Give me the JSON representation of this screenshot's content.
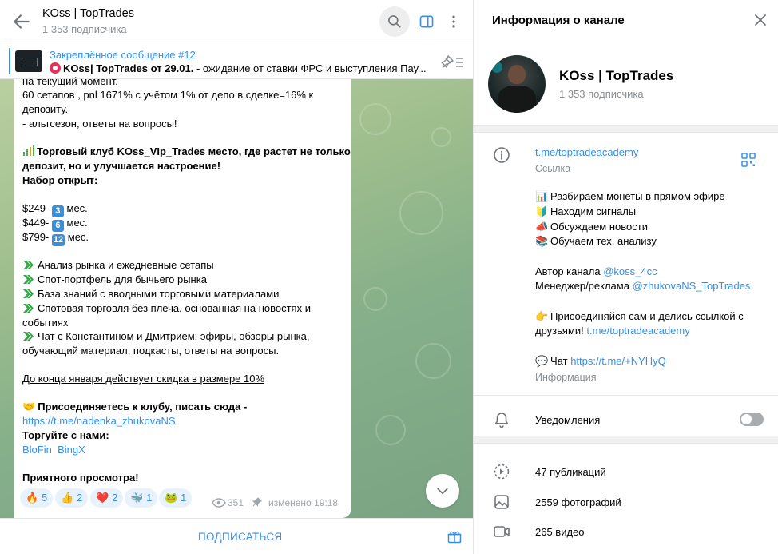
{
  "header": {
    "title": "KOss | TopTrades",
    "subtitle": "1 353 подписчика"
  },
  "pinned": {
    "title": "Закреплённое сообщение #12",
    "text_bold": "KOss| TopTrades от 29.01.",
    "text_rest": " - ожидание от ставки ФРС и выступления Пау..."
  },
  "message": {
    "lines": [
      "на текущий момент.",
      "60 сетапов , pnl 1671% с учётом 1% от депо в сделке=16% к",
      "депозиту.",
      "- альтсезон, ответы на вопросы!"
    ],
    "club_1": "Торговый клуб KOss_VIp_Trades место, где растет не только",
    "club_2": "депозит, но и улучшается настроение!",
    "recruit": "Набор открыт:",
    "prices": [
      {
        "price": "$249-",
        "badge": "3",
        "unit": "мес."
      },
      {
        "price": "$449-",
        "badge": "6",
        "unit": "мес."
      },
      {
        "price": "$799-",
        "badge": "12",
        "unit": "мес."
      }
    ],
    "features": [
      "Анализ рынка и ежедневные  сетапы",
      "Спот-портфель для бычьего рынка",
      "База знаний с вводными торговыми материалами",
      "Спотовая торговля без плеча, основанная на новостях и",
      "событиях",
      "Чат с Константином и Дмитрием:  эфиры, обзоры рынка,",
      "обучающий материал, подкасты, ответы на вопросы."
    ],
    "discount": "До конца января действует скидка в размере 10%",
    "join": "Присоединяетесь к клубу, писать сюда -",
    "join_link": "https://t.me/nadenka_zhukovaNS",
    "trade_with": "Торгуйте с нами:",
    "exchange_1": "BloFin",
    "exchange_2": "BingX",
    "enjoy": "Приятного просмотра!"
  },
  "reactions": [
    {
      "emoji": "🔥",
      "count": "5"
    },
    {
      "emoji": "👍",
      "count": "2"
    },
    {
      "emoji": "❤️",
      "count": "2"
    },
    {
      "emoji": "🐳",
      "count": "1"
    },
    {
      "emoji": "🐸",
      "count": "1"
    }
  ],
  "meta": {
    "views": "351",
    "edited": "изменено 19:18"
  },
  "footer": {
    "subscribe": "ПОДПИСАТЬСЯ"
  },
  "info": {
    "title": "Информация о канале",
    "channel_name": "KOss | TopTrades",
    "channel_subs": "1 353 подписчика",
    "link": "t.me/toptradeacademy",
    "link_label": "Ссылка",
    "bullets": [
      {
        "emoji": "📊",
        "text": "Разбираем монеты в прямом эфире"
      },
      {
        "emoji": "🔰",
        "text": "Находим сигналы"
      },
      {
        "emoji": "📣",
        "text": "Обсуждаем новости"
      },
      {
        "emoji": "📚",
        "text": "Обучаем тех. анализу"
      }
    ],
    "author_label": "Автор канала",
    "author_link": "@koss_4cc",
    "manager_label": "Менеджер/реклама",
    "manager_link": "@zhukovaNS_TopTrades",
    "join_emoji": "👉",
    "join_text_1": "Присоединяйся сам и делись ссылкой с",
    "join_text_2": "друзьями!",
    "join_link": "t.me/toptradeacademy",
    "chat_emoji": "💬",
    "chat_label": "Чат",
    "chat_link": "https://t.me/+NYHyQ",
    "info_label": "Информация",
    "notifications": "Уведомления",
    "publications": "47 публикаций",
    "photos": "2559 фотографий",
    "videos": "265 видео"
  },
  "colors": {
    "accent": "#3390ec",
    "chat_bg": "#9dbd8d",
    "muted": "#8a8f93"
  }
}
